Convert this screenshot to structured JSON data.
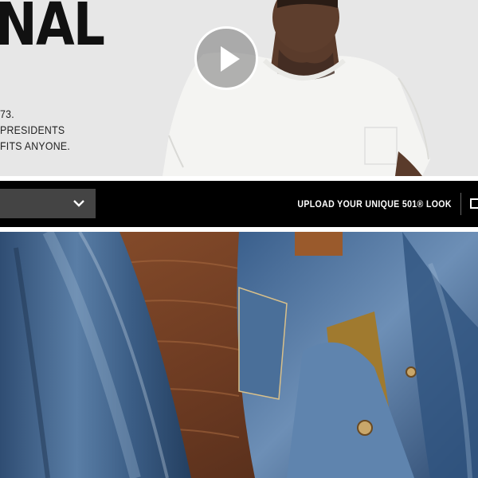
{
  "hero": {
    "title": "NAL",
    "copy_lines": [
      "73.",
      "PRESIDENTS",
      "FITS ANYONE."
    ],
    "play_icon": "play-icon"
  },
  "toolbar": {
    "select_value": "",
    "select_icon": "chevron-down-icon",
    "upload_label": "UPLOAD YOUR UNIQUE 501® LOOK",
    "checkbox_icon": "checkbox-icon"
  },
  "colors": {
    "hero_bg": "#e7e7e7",
    "bar_bg": "#000000",
    "select_bg": "#444444",
    "denim": "#3d5f87",
    "wood": "#7a4528"
  }
}
